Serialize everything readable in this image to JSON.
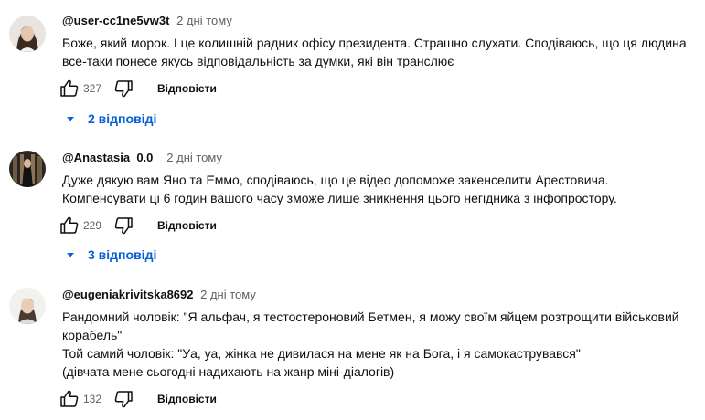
{
  "comments": [
    {
      "author": "@user-cc1ne5vw3t",
      "time": "2 дні тому",
      "text_lines": [
        "Боже, який морок. І це колишній радник офісу президента. Страшно слухати. Сподіваюсь, що ця людина",
        "все-таки понесе якусь відповідальність за думки, які він транслює"
      ],
      "likes": "327",
      "reply_label": "Відповісти",
      "replies_label": "2 відповіді"
    },
    {
      "author": "@Anastasia_0.0_",
      "time": "2 дні тому",
      "text_lines": [
        "Дуже дякую вам Яно та Еммо, сподіваюсь, що це відео допоможе закенселити Арестовича.",
        "Компенсувати ці 6 годин вашого часу зможе лише зникнення цього негідника з інфопростору."
      ],
      "likes": "229",
      "reply_label": "Відповісти",
      "replies_label": "3 відповіді"
    },
    {
      "author": "@eugeniakrivitska8692",
      "time": "2 дні тому",
      "text_lines": [
        "Рандомний чоловік: \"Я альфач, я тестостероновий Бетмен, я можу своїм яйцем розтрощити військовий",
        "корабель\"",
        "Той самий чоловік: \"Уа, уа, жінка не дивилася на мене як на Бога, і я самокаструвався\"",
        "(дівчата мене сьогодні надихають на жанр міні-діалогів)"
      ],
      "likes": "132",
      "reply_label": "Відповісти"
    }
  ],
  "colors": {
    "link_blue": "#065fd4",
    "meta_gray": "#606060",
    "text": "#0f0f0f"
  },
  "icons": {
    "like": "thumb-up-icon",
    "dislike": "thumb-down-icon",
    "expand": "chevron-down-icon"
  }
}
